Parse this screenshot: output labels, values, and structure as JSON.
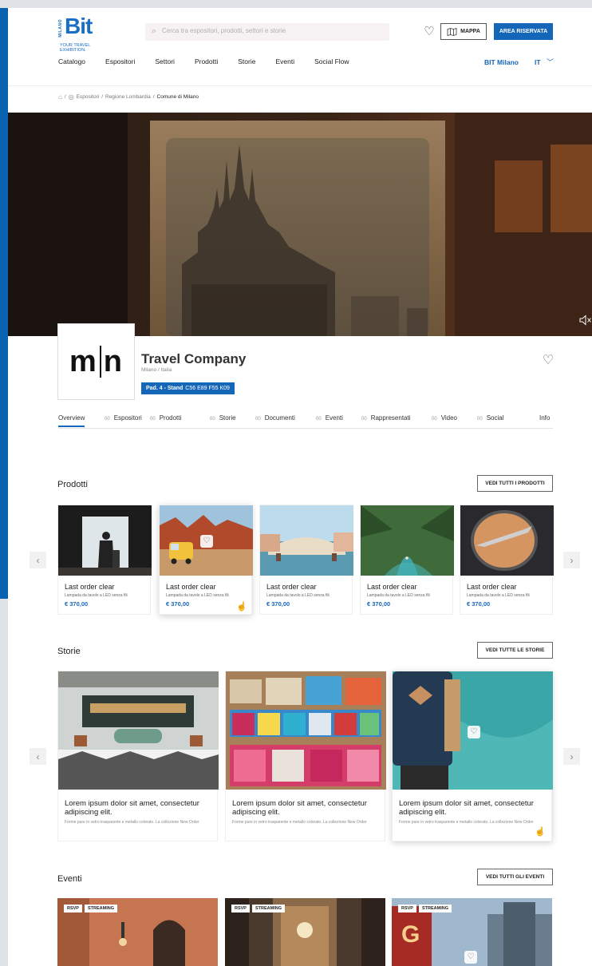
{
  "header": {
    "logo": {
      "milano": "MILANO",
      "brand": "Bit",
      "tagline_1": "YOUR TRAVEL",
      "tagline_2": "EXHIBITION."
    },
    "search_placeholder": "Cerca tra espositori, prodotti, settori e storie",
    "map_label": "MAPPA",
    "reserved_label": "AREA RISERVATA",
    "nav": [
      "Catalogo",
      "Espositori",
      "Settori",
      "Prodotti",
      "Storie",
      "Eventi",
      "Social Flow"
    ],
    "bit_milano": "BIT Milano",
    "lang": "IT"
  },
  "breadcrumb": {
    "home_sep": "/",
    "exhibitors": "Espositori",
    "region": "Regione Lombardia",
    "current": "Comune di Milano",
    "sep": "/"
  },
  "company": {
    "logo_left": "m",
    "logo_right": "n",
    "name": "Travel Company",
    "location": "Milano / Italia",
    "pad_label": "Pad. 4 - Stand",
    "stand_codes": "C56 E89 F55 K09"
  },
  "tabs": [
    {
      "count": "",
      "label": "Overview"
    },
    {
      "count": "00",
      "label": "Espositori"
    },
    {
      "count": "00",
      "label": "Prodotti"
    },
    {
      "count": "00",
      "label": "Storie"
    },
    {
      "count": "00",
      "label": "Documenti"
    },
    {
      "count": "00",
      "label": "Eventi"
    },
    {
      "count": "00",
      "label": "Rappresentati"
    },
    {
      "count": "00",
      "label": "Video"
    },
    {
      "count": "00",
      "label": "Social"
    },
    {
      "count": "",
      "label": "Info"
    }
  ],
  "products": {
    "title": "Prodotti",
    "see_all": "VEDI TUTTI I PRODOTTI",
    "items": [
      {
        "title": "Last order clear",
        "subtitle": "Lampada da tavolo a LED senza fili",
        "price": "€ 370,00"
      },
      {
        "title": "Last order clear",
        "subtitle": "Lampada da tavolo a LED senza fili",
        "price": "€ 370,00"
      },
      {
        "title": "Last order clear",
        "subtitle": "Lampada da tavolo a LED senza fili",
        "price": "€ 370,00"
      },
      {
        "title": "Last order clear",
        "subtitle": "Lampada da tavolo a LED senza fili",
        "price": "€ 370,00"
      },
      {
        "title": "Last order clear",
        "subtitle": "Lampada da tavolo a LED senza fili",
        "price": "€ 370,00"
      }
    ]
  },
  "stories": {
    "title": "Storie",
    "see_all": "VEDI TUTTE LE STORIE",
    "items": [
      {
        "title": "Lorem ipsum dolor sit amet, consectetur adipiscing elit.",
        "subtitle": "Forme pure in vetro trasparente e metallo colorato. La collezione New Order"
      },
      {
        "title": "Lorem ipsum dolor sit amet, consectetur adipiscing elit.",
        "subtitle": "Forme pure in vetro trasparente e metallo colorato. La collezione New Order"
      },
      {
        "title": "Lorem ipsum dolor sit amet, consectetur adipiscing elit.",
        "subtitle": "Forme pure in vetro trasparente e metallo colorato. La collezione New Order"
      }
    ]
  },
  "events": {
    "title": "Eventi",
    "see_all": "VEDI TUTTI GLI EVENTI",
    "badges": [
      "RSVP",
      "STREAMING"
    ]
  },
  "icons": {
    "search": "search-icon",
    "heart": "heart-icon",
    "map": "map-icon",
    "home": "home-icon",
    "user": "user-circle-icon",
    "chevron": "chevron-down-icon",
    "arrow_left": "chevron-left-icon",
    "arrow_right": "chevron-right-icon",
    "mute": "speaker-mute-icon",
    "cursor": "hand-cursor-icon"
  },
  "colors": {
    "brand_blue": "#1466b8",
    "side_accent": "#0a63b0"
  }
}
